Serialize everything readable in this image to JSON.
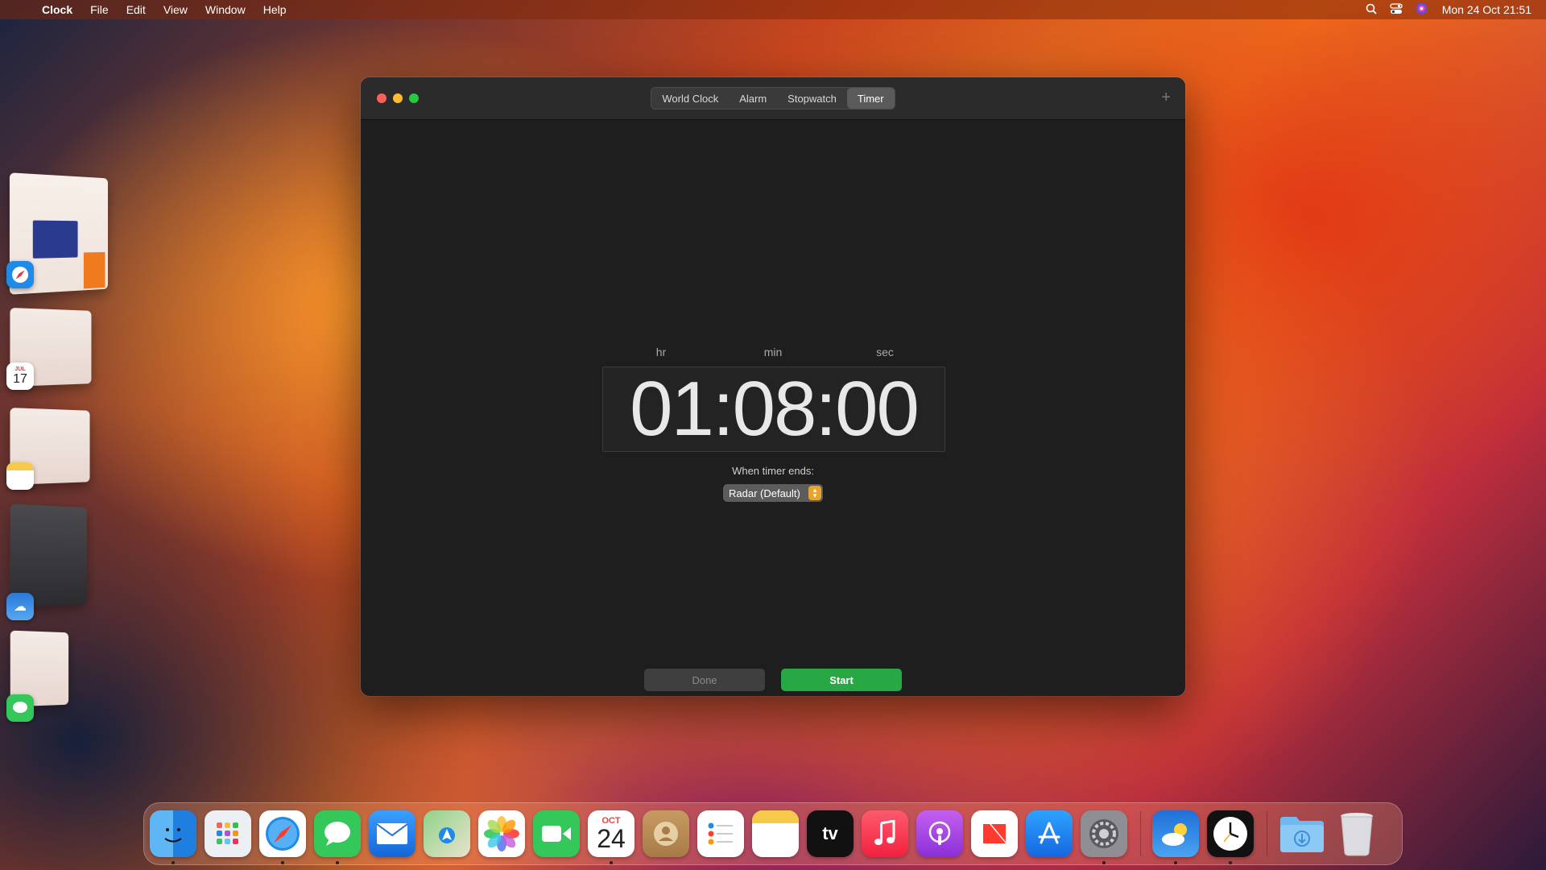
{
  "menubar": {
    "app_name": "Clock",
    "items": [
      "File",
      "Edit",
      "View",
      "Window",
      "Help"
    ],
    "datetime": "Mon 24 Oct  21:51"
  },
  "stage_manager": {
    "calendar_month": "JUL",
    "calendar_day": "17"
  },
  "window": {
    "tabs": [
      "World Clock",
      "Alarm",
      "Stopwatch",
      "Timer"
    ],
    "active_tab": "Timer",
    "add_label": "+",
    "units": {
      "hr": "hr",
      "min": "min",
      "sec": "sec"
    },
    "time": {
      "hours": "01",
      "minutes": "08",
      "seconds": "00",
      "separator": ":"
    },
    "when_ends_label": "When timer ends:",
    "sound_select": "Radar (Default)",
    "done_label": "Done",
    "start_label": "Start"
  },
  "dock": {
    "calendar_month": "OCT",
    "calendar_day": "24",
    "tv_label": "tv",
    "apps": [
      "finder",
      "launchpad",
      "safari",
      "messages",
      "mail",
      "maps",
      "photos",
      "facetime",
      "calendar",
      "contacts",
      "reminders",
      "notes",
      "tv",
      "music",
      "podcasts",
      "news",
      "app-store",
      "system-settings",
      "weather",
      "clock",
      "downloads",
      "trash"
    ]
  },
  "colors": {
    "start_button": "#28a745",
    "close": "#ff5f57",
    "minimize": "#febc2e",
    "zoom": "#28c840",
    "select_stepper": "#e8a52a"
  }
}
